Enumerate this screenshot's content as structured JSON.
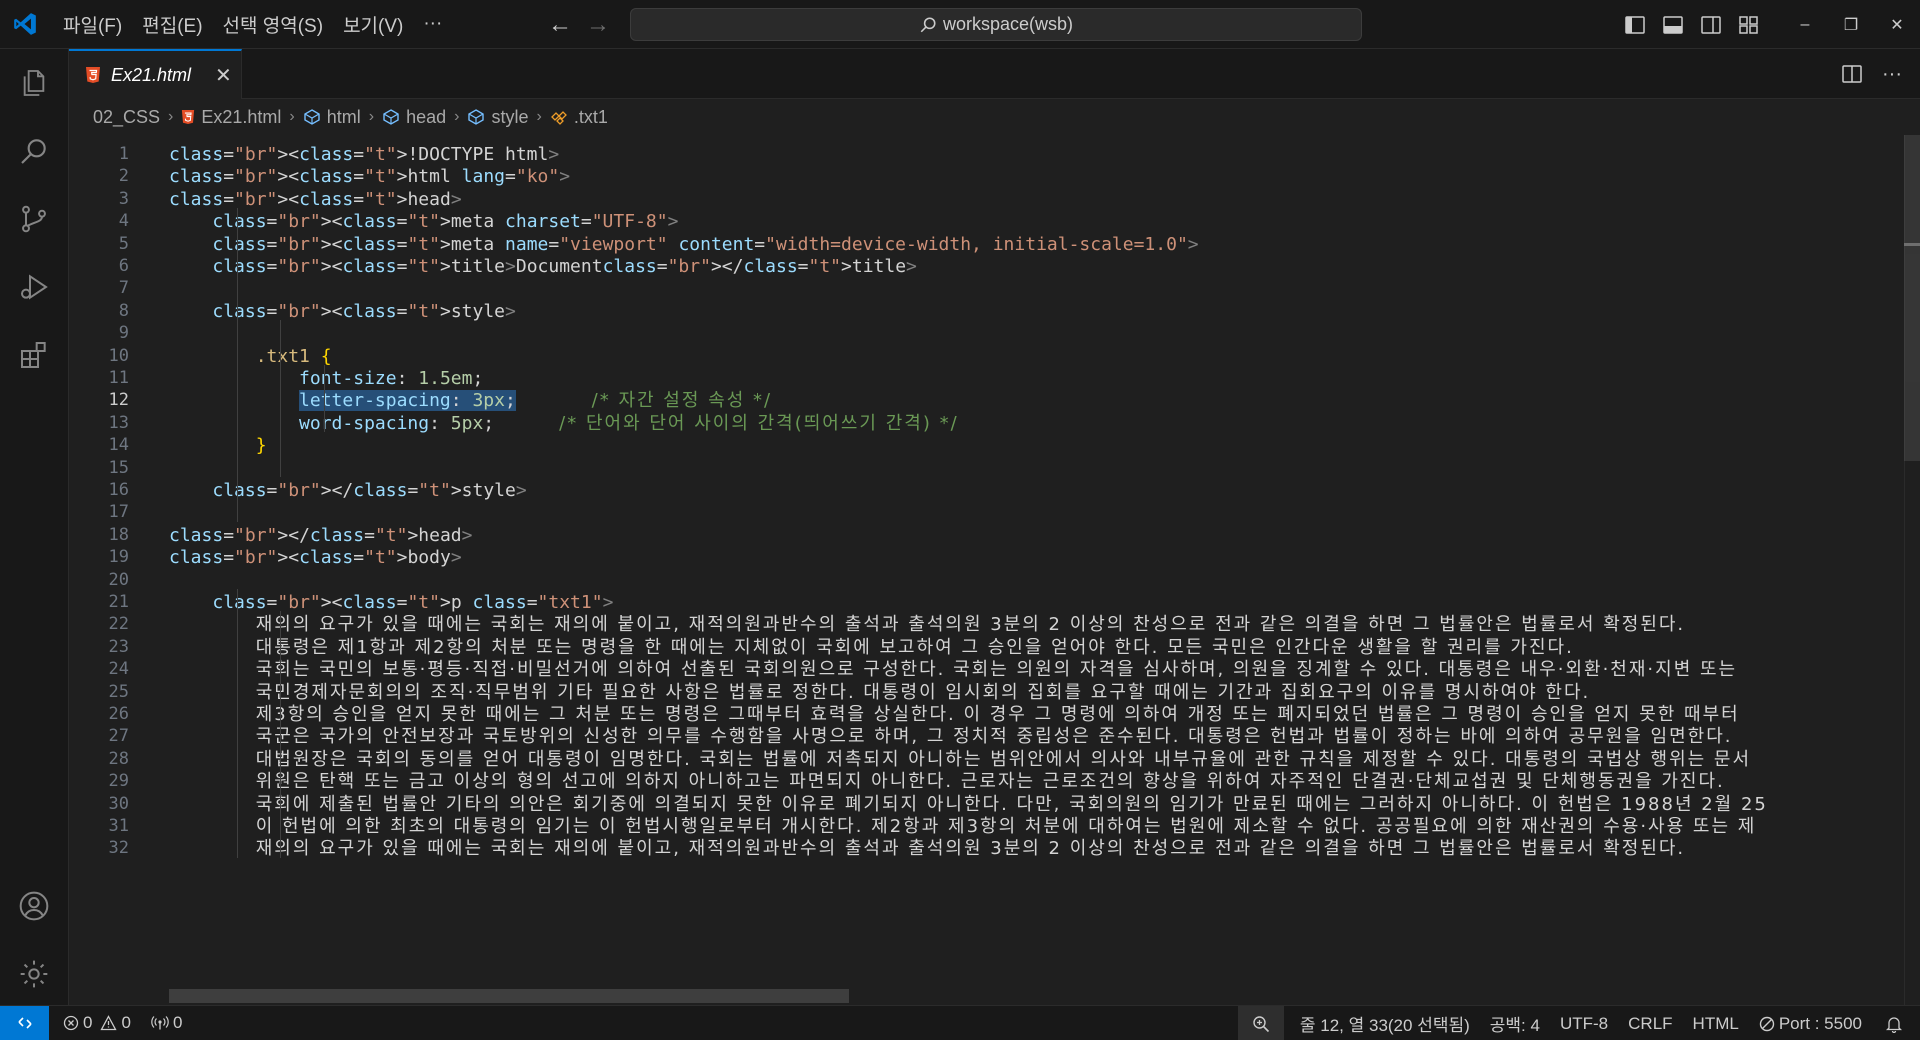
{
  "menu": [
    "파일(F)",
    "편집(E)",
    "선택 영역(S)",
    "보기(V)",
    "···"
  ],
  "command_center": {
    "label": "workspace(wsb)"
  },
  "window_controls": {
    "minimize": "–",
    "restore": "❐",
    "close": "✕"
  },
  "tab": {
    "label": "Ex21.html",
    "close": "✕"
  },
  "breadcrumb": [
    "02_CSS",
    "Ex21.html",
    "html",
    "head",
    "style",
    ".txt1"
  ],
  "editor": {
    "active_line": 12,
    "lines": [
      "<!DOCTYPE html>",
      "<html lang=\"ko\">",
      "<head>",
      "    <meta charset=\"UTF-8\">",
      "    <meta name=\"viewport\" content=\"width=device-width, initial-scale=1.0\">",
      "    <title>Document</title>",
      "",
      "    <style>",
      "",
      "        .txt1 {",
      "            font-size: 1.5em;",
      "            letter-spacing: 3px;       /* 자간 설정 속성 */",
      "            word-spacing: 5px;      /* 단어와 단어 사이의 간격(띄어쓰기 간격) */",
      "        }",
      "",
      "    </style>",
      "",
      "</head>",
      "<body>",
      "",
      "    <p class=\"txt1\">",
      "        재의의 요구가 있을 때에는 국회는 재의에 붙이고, 재적의원과반수의 출석과 출석의원 3분의 2 이상의 찬성으로 전과 같은 의결을 하면 그 법률안은 법률로서 확정된다.",
      "        대통령은 제1항과 제2항의 처분 또는 명령을 한 때에는 지체없이 국회에 보고하여 그 승인을 얻어야 한다. 모든 국민은 인간다운 생활을 할 권리를 가진다.",
      "        국회는 국민의 보통·평등·직접·비밀선거에 의하여 선출된 국회의원으로 구성한다. 국회는 의원의 자격을 심사하며, 의원을 징계할 수 있다. 대통령은 내우·외환·천재·지변 또는",
      "        국민경제자문회의의 조직·직무범위 기타 필요한 사항은 법률로 정한다. 대통령이 임시회의 집회를 요구할 때에는 기간과 집회요구의 이유를 명시하여야 한다.",
      "        제3항의 승인을 얻지 못한 때에는 그 처분 또는 명령은 그때부터 효력을 상실한다. 이 경우 그 명령에 의하여 개정 또는 폐지되었던 법률은 그 명령이 승인을 얻지 못한 때부터",
      "        국군은 국가의 안전보장과 국토방위의 신성한 의무를 수행함을 사명으로 하며, 그 정치적 중립성은 준수된다. 대통령은 헌법과 법률이 정하는 바에 의하여 공무원을 임면한다.",
      "        대법원장은 국회의 동의를 얻어 대통령이 임명한다. 국회는 법률에 저촉되지 아니하는 범위안에서 의사와 내부규율에 관한 규칙을 제정할 수 있다. 대통령의 국법상 행위는 문서",
      "        위원은 탄핵 또는 금고 이상의 형의 선고에 의하지 아니하고는 파면되지 아니한다. 근로자는 근로조건의 향상을 위하여 자주적인 단결권·단체교섭권 및 단체행동권을 가진다.",
      "        국회에 제출된 법률안 기타의 의안은 회기중에 의결되지 못한 이유로 폐기되지 아니한다. 다만, 국회의원의 임기가 만료된 때에는 그러하지 아니하다. 이 헌법은 1988년 2월 25",
      "        이 헌법에 의한 최초의 대통령의 임기는 이 헌법시행일로부터 개시한다. 제2항과 제3항의 처분에 대하여는 법원에 제소할 수 없다. 공공필요에 의한 재산권의 수용·사용 또는 제",
      "        재의의 요구가 있을 때에는 국회는 재의에 붙이고, 재적의원과반수의 출석과 출석의원 3분의 2 이상의 찬성으로 전과 같은 의결을 하면 그 법률안은 법률로서 확정된다."
    ]
  },
  "status": {
    "errors": "0",
    "warnings": "0",
    "ports": "0",
    "cursor": "줄 12, 열 33(20 선택됨)",
    "spaces": "공백: 4",
    "encoding": "UTF-8",
    "eol": "CRLF",
    "language": "HTML",
    "port": "Port : 5500"
  },
  "colors": {
    "accent": "#0078d4",
    "background": "#1f1f1f",
    "chrome": "#181818"
  }
}
